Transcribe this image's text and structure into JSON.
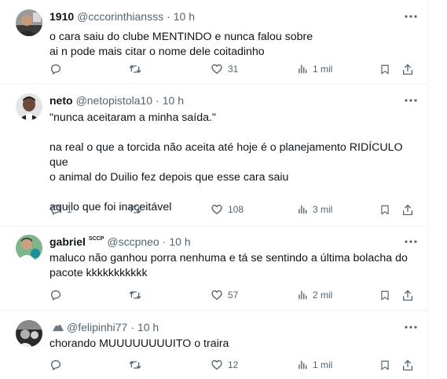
{
  "tweets": [
    {
      "name": "1910",
      "handle": "@cccorinthiansss",
      "time": "10 h",
      "text": "o cara saiu do clube MENTINDO e nunca falou sobre\nai n pode mais citar o nome dele coitadinho",
      "replies": "",
      "retweets": "",
      "likes": "31",
      "views": "1 mil"
    },
    {
      "name": "neto",
      "handle": "@netopistola10",
      "time": "10 h",
      "text": "\"nunca aceitaram a minha saída.\"\n\nna real o que a torcida não aceita até hoje é o planejamento RIDÍCULO que\no animal do Duilio fez depois que esse cara saiu\n\naquilo que foi inaceitável",
      "replies": "1",
      "retweets": "",
      "likes": "108",
      "views": "3 mil"
    },
    {
      "name": "gabriel",
      "badge": "SCCP",
      "handle": "@sccpneo",
      "time": "10 h",
      "text": "maluco não ganhou porra nenhuma e tá se sentindo a última bolacha do\npacote kkkkkkkkkkk",
      "replies": "",
      "retweets": "",
      "likes": "57",
      "views": "2 mil"
    },
    {
      "name": "",
      "handle": "@felipinhi77",
      "time": "10 h",
      "text": "chorando MUUUUUUUUITO o traira",
      "replies": "",
      "retweets": "",
      "likes": "12",
      "views": "1 mil"
    }
  ],
  "icons": {
    "reply": "reply-icon",
    "retweet": "retweet-icon",
    "like": "heart-icon",
    "views": "views-icon",
    "bookmark": "bookmark-icon",
    "share": "share-icon",
    "more": "more-icon"
  },
  "colors": {
    "text": "#0f1419",
    "secondary": "#536471",
    "border": "#eff3f4"
  }
}
